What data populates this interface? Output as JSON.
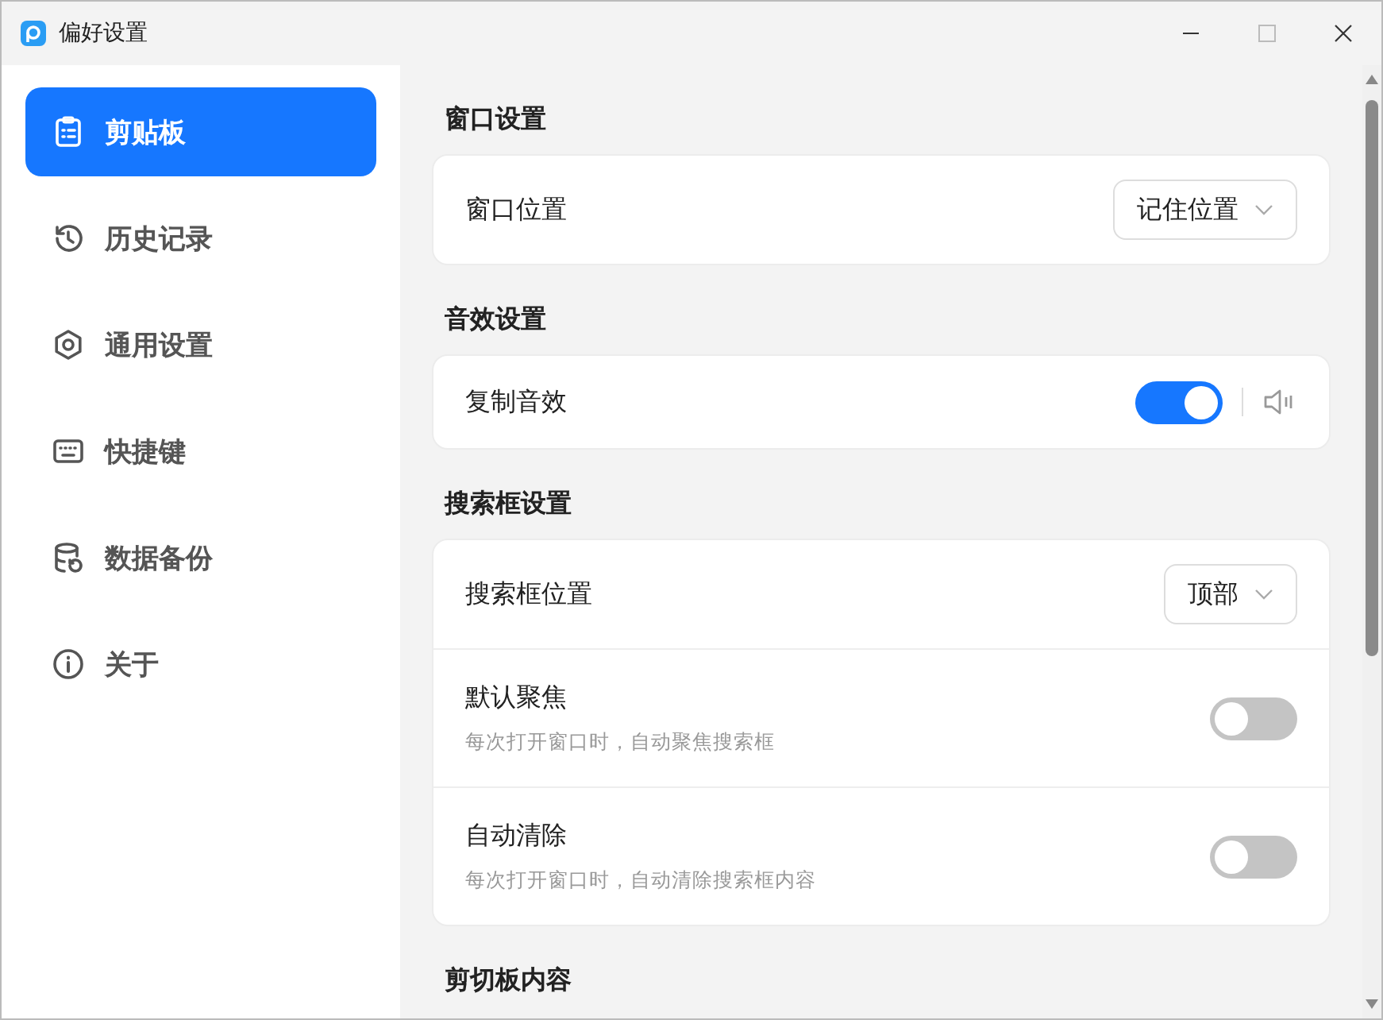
{
  "window": {
    "title": "偏好设置"
  },
  "sidebar": {
    "items": [
      {
        "label": "剪贴板",
        "selected": true
      },
      {
        "label": "历史记录",
        "selected": false
      },
      {
        "label": "通用设置",
        "selected": false
      },
      {
        "label": "快捷键",
        "selected": false
      },
      {
        "label": "数据备份",
        "selected": false
      },
      {
        "label": "关于",
        "selected": false
      }
    ]
  },
  "sections": [
    {
      "title": "窗口设置",
      "rows": [
        {
          "kind": "select",
          "label": "窗口位置",
          "value": "记住位置"
        }
      ]
    },
    {
      "title": "音效设置",
      "rows": [
        {
          "kind": "switch",
          "label": "复制音效",
          "on": true,
          "sound_button": true
        }
      ]
    },
    {
      "title": "搜索框设置",
      "rows": [
        {
          "kind": "select",
          "label": "搜索框位置",
          "value": "顶部"
        },
        {
          "kind": "switch",
          "label": "默认聚焦",
          "description": "每次打开窗口时，自动聚焦搜索框",
          "on": false
        },
        {
          "kind": "switch",
          "label": "自动清除",
          "description": "每次打开窗口时，自动清除搜索框内容",
          "on": false
        }
      ]
    },
    {
      "title": "剪切板内容"
    }
  ]
}
